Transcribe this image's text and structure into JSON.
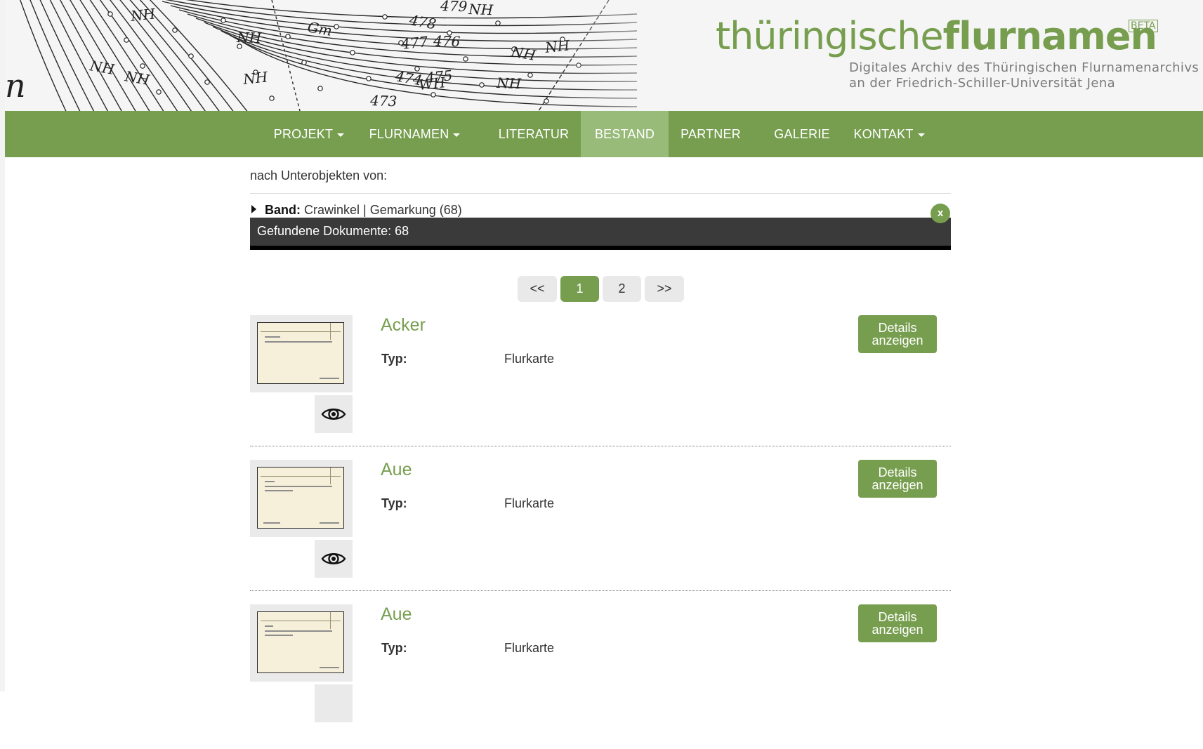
{
  "logo": {
    "part_light": "thüringische",
    "part_bold": "flurnamen",
    "badge": "BETA",
    "subtitle_line1": "Digitales Archiv des Thüringischen Flurnamenarchivs",
    "subtitle_line2": "an der Friedrich-Schiller-Universität Jena"
  },
  "header_map_annotations": [
    "NH",
    "NH",
    "NH",
    "NH",
    "NH",
    "NH",
    "NH",
    "NH",
    "NH",
    "WH",
    "479",
    "478",
    "477",
    "476",
    "474",
    "475",
    "473",
    "Gm"
  ],
  "nav": [
    {
      "label": "PROJEKT",
      "dropdown": true,
      "active": false
    },
    {
      "label": "FLURNAMEN",
      "dropdown": true,
      "active": false
    },
    {
      "label": "LITERATUR",
      "dropdown": false,
      "active": false
    },
    {
      "label": "BESTAND",
      "dropdown": false,
      "active": true
    },
    {
      "label": "PARTNER",
      "dropdown": false,
      "active": false
    },
    {
      "label": "GALERIE",
      "dropdown": false,
      "active": false
    },
    {
      "label": "KONTAKT",
      "dropdown": true,
      "active": false
    }
  ],
  "filter": {
    "heading": "nach Unterobjekten von:",
    "band_label": "Band:",
    "band_value": "Crawinkel | Gemarkung (68)",
    "remove_label": "x"
  },
  "results": {
    "found_text": "Gefundene Dokumente: 68"
  },
  "pagination": {
    "first": "<<",
    "pages": [
      "1",
      "2"
    ],
    "current": "1",
    "last": ">>"
  },
  "items": [
    {
      "title": "Acker",
      "typ_label": "Typ:",
      "typ_value": "Flurkarte",
      "button": "Details anzeigen"
    },
    {
      "title": "Aue",
      "typ_label": "Typ:",
      "typ_value": "Flurkarte",
      "button": "Details anzeigen"
    },
    {
      "title": "Aue",
      "typ_label": "Typ:",
      "typ_value": "Flurkarte",
      "button": "Details anzeigen"
    }
  ],
  "icons": {
    "view": "eye-icon",
    "dropdown": "caret-down-icon",
    "expand": "triangle-right-icon"
  },
  "colors": {
    "brand_green": "#779e4f",
    "nav_active": "#98bb79",
    "results_bar": "#3a3a3a"
  }
}
